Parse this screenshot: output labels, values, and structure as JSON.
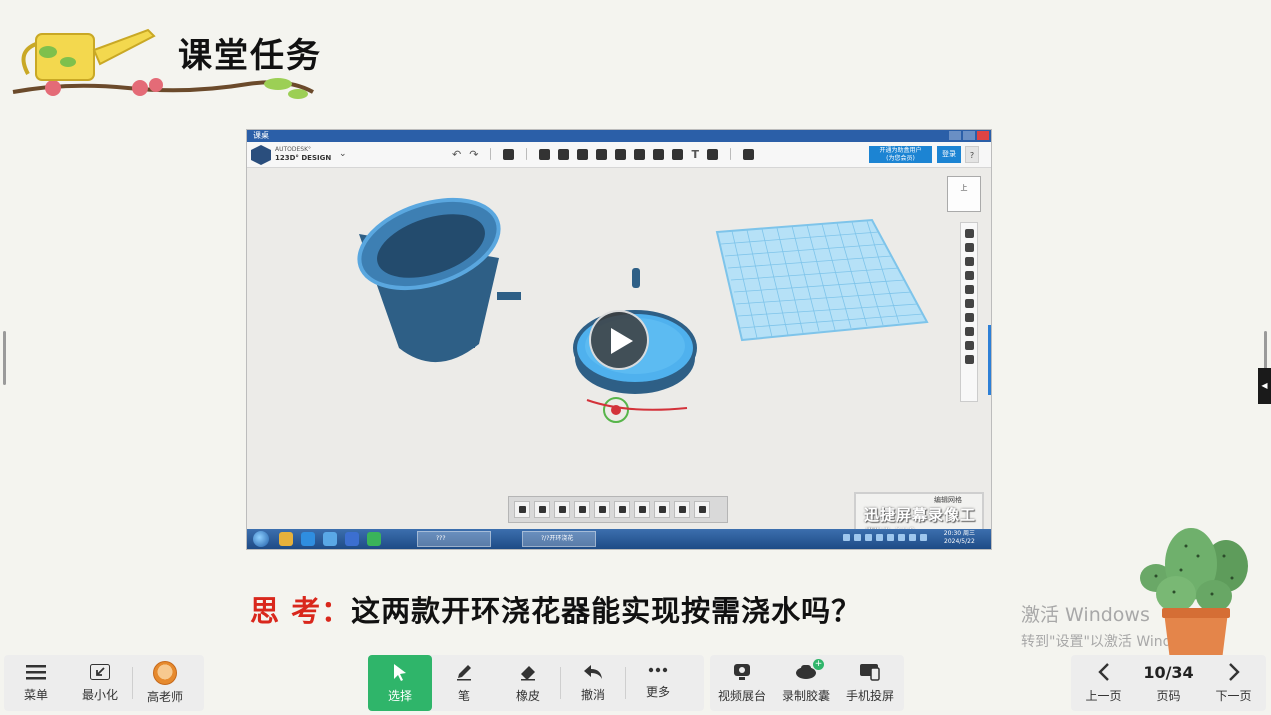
{
  "slide": {
    "title": "课堂任务",
    "question_prefix": "思 考：",
    "question_text": "这两款开环浇花器能实现按需浇水吗？"
  },
  "video": {
    "window_title": "课桌",
    "app_brand_top": "AUTODESK°",
    "app_brand_name": "123D° DESIGN",
    "open_button": "开通为助盒用户",
    "open_button_sub": "(为您会员)",
    "login_button": "登录",
    "help_button": "?",
    "viewcube_label": "上",
    "watermark_small": "编辑网格",
    "watermark_big": "迅捷屏幕录像工具",
    "watermark_url": "www.xun",
    "taskbar_task1": "???",
    "taskbar_task2": "?/?开环浇花",
    "clock_time": "20:30 周三",
    "clock_date": "2024/5/22",
    "play_label": "播放"
  },
  "watermark": {
    "line1": "激活 Windows",
    "line2": "转到\"设置\"以激活 Windows。"
  },
  "toolbar": {
    "left": [
      {
        "label": "菜单",
        "icon": "menu-icon"
      },
      {
        "label": "最小化",
        "icon": "minimize-icon"
      },
      {
        "label": "高老师",
        "icon": "avatar-icon"
      }
    ],
    "tools": [
      {
        "label": "选择",
        "icon": "cursor-icon",
        "active": true
      },
      {
        "label": "笔",
        "icon": "pen-icon"
      },
      {
        "label": "橡皮",
        "icon": "eraser-icon"
      },
      {
        "label": "撤消",
        "icon": "undo-icon"
      },
      {
        "label": "更多",
        "icon": "more-icon"
      }
    ],
    "media": [
      {
        "label": "视频展台",
        "icon": "camera-icon"
      },
      {
        "label": "录制胶囊",
        "icon": "record-icon",
        "badge": "+"
      },
      {
        "label": "手机投屏",
        "icon": "phone-cast-icon"
      }
    ],
    "pager": {
      "prev": "上一页",
      "current": "10/34",
      "page_label": "页码",
      "next": "下一页"
    }
  },
  "colors": {
    "accent_green": "#2fb56a",
    "question_red": "#d9271c",
    "autodesk_blue": "#1c84d3"
  }
}
